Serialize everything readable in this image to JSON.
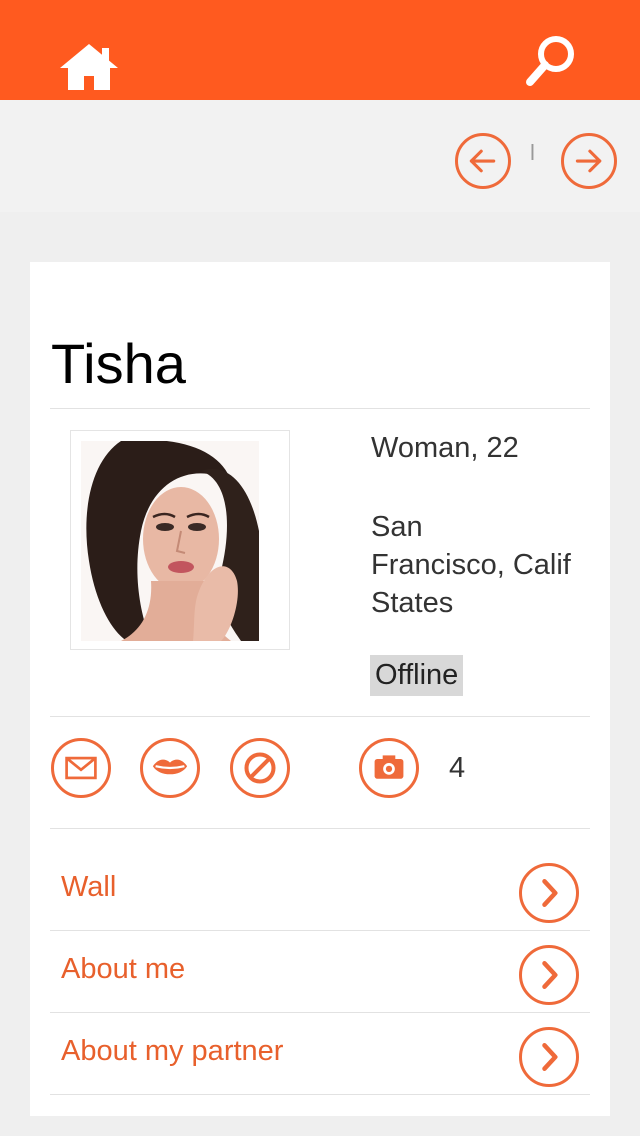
{
  "topbar": {
    "home_icon": "home-icon",
    "search_icon": "search-icon"
  },
  "pager": {
    "separator": "l"
  },
  "profile": {
    "name": "Tisha",
    "gender_age": "Woman, 22",
    "location_lines": [
      "San",
      "Francisco, California, United",
      "States"
    ],
    "status": "Offline",
    "photo_count": "4"
  },
  "actions": [
    "mail-icon",
    "kiss-icon",
    "block-icon",
    "camera-icon"
  ],
  "menu": [
    {
      "label": "Wall"
    },
    {
      "label": "About me"
    },
    {
      "label": "About my partner"
    }
  ],
  "colors": {
    "brand": "#ff5a1f",
    "accent": "#ef6a3a",
    "link": "#e8602c"
  }
}
